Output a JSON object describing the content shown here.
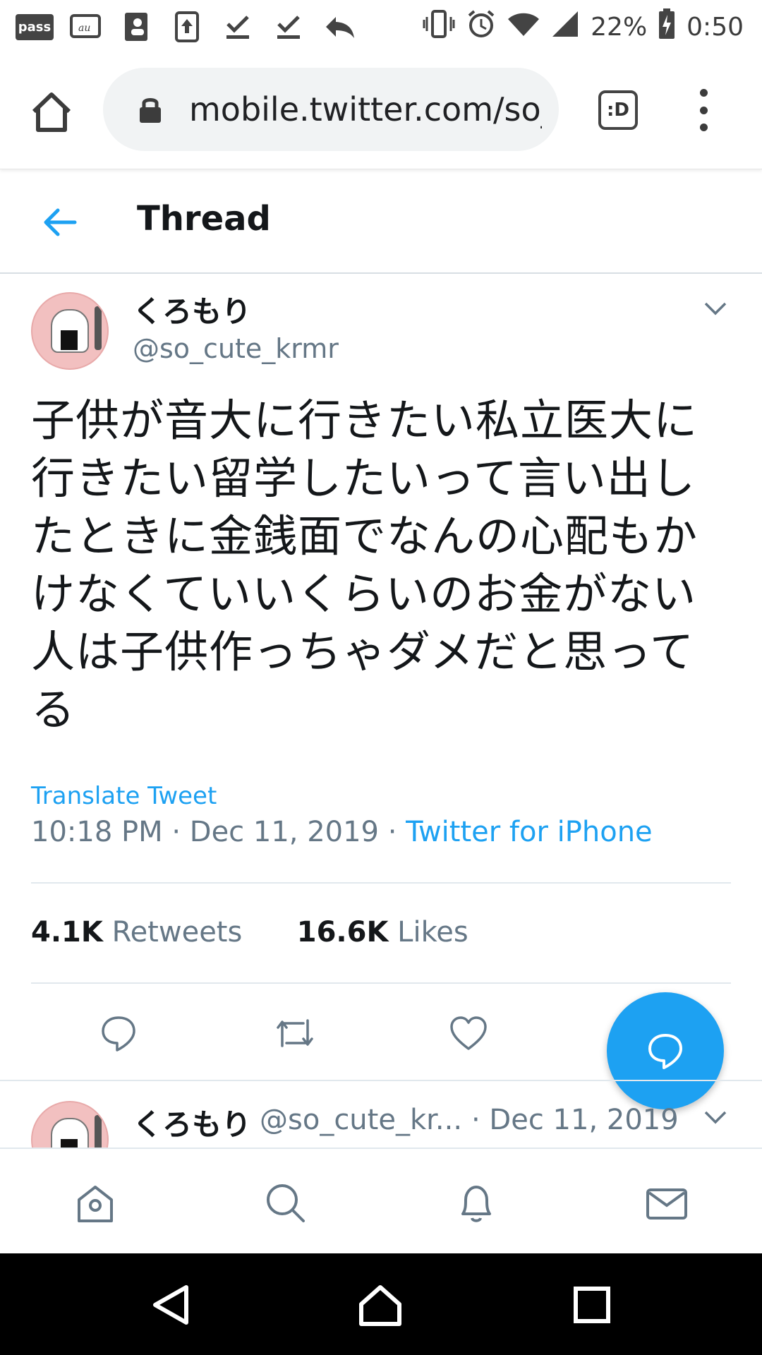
{
  "status_bar": {
    "left_icons": [
      "pass-icon",
      "au-icon",
      "contacts-icon",
      "upload-icon",
      "download-done-icon",
      "download-done-icon",
      "reply-icon"
    ],
    "pass_label": "pass",
    "battery": "22%",
    "time": "0:50"
  },
  "browser": {
    "url": "mobile.twitter.com/so_",
    "tabs_label": ":D"
  },
  "header": {
    "title": "Thread"
  },
  "tweet": {
    "name": "くろもり",
    "handle": "@so_cute_krmr",
    "text": "子供が音大に行きたい私立医大に行きたい留学したいって言い出したときに金銭面でなんの心配もかけなくていいくらいのお金がない人は子供作っちゃダメだと思ってる",
    "translate_label": "Translate Tweet",
    "time": "10:18 PM · Dec 11, 2019 · ",
    "source": "Twitter for iPhone",
    "retweets_count": "4.1K",
    "retweets_label": "Retweets",
    "likes_count": "16.6K",
    "likes_label": "Likes"
  },
  "reply": {
    "name": "くろもり",
    "handle": "@so_cute_kr...",
    "date": "· Dec 11, 2019"
  },
  "colors": {
    "accent": "#1da1f2",
    "secondary_text": "#657786",
    "primary_text": "#14171a"
  }
}
